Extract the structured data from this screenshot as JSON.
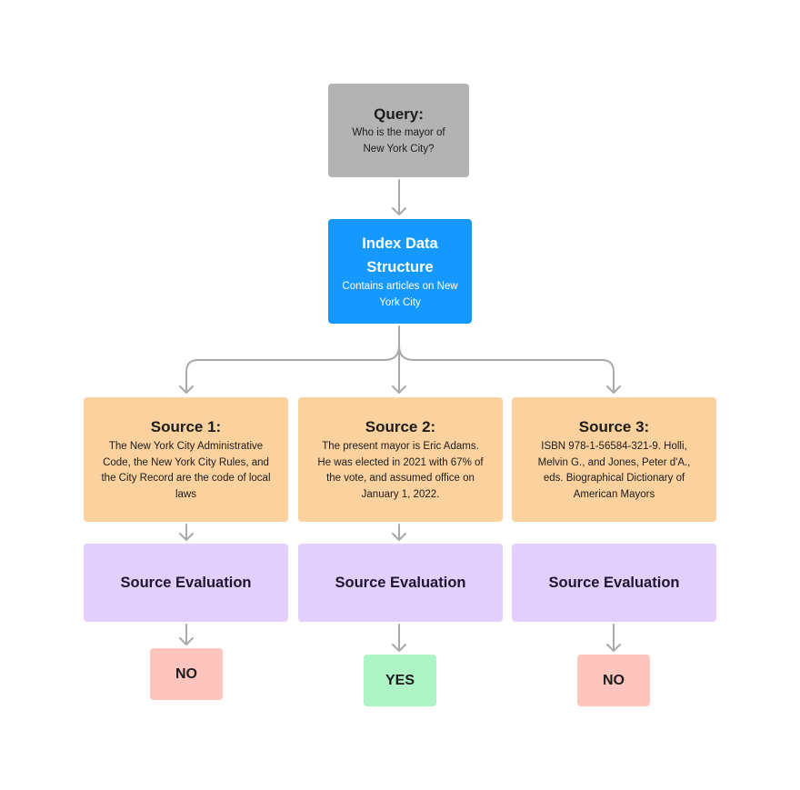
{
  "query": {
    "title": "Query:",
    "text": "Who is the mayor of New York City?"
  },
  "index": {
    "title": "Index Data Structure",
    "text": "Contains articles on New York City",
    "color": "#1599ff"
  },
  "sources": [
    {
      "title": "Source 1:",
      "text": "The New York City Administrative Code, the New York City Rules, and the City Record are the code of local laws"
    },
    {
      "title": "Source 2:",
      "text": "The present mayor is Eric Adams. He was elected in 2021 with 67% of the vote, and assumed office on January 1, 2022."
    },
    {
      "title": "Source 3:",
      "text": "ISBN 978-1-56584-321-9. Holli, Melvin G., and Jones, Peter d'A., eds. Biographical Dictionary of American Mayors"
    }
  ],
  "evaluations": [
    {
      "label": "Source Evaluation"
    },
    {
      "label": "Source Evaluation"
    },
    {
      "label": "Source Evaluation"
    }
  ],
  "verdicts": [
    {
      "label": "NO",
      "status": "no",
      "color": "#fec4be"
    },
    {
      "label": "YES",
      "status": "yes",
      "color": "#aff4c6"
    },
    {
      "label": "NO",
      "status": "no",
      "color": "#fec4be"
    }
  ],
  "colors": {
    "query": "#b3b3b3",
    "source": "#fbd19e",
    "evaluation": "#e3cffc",
    "connector": "#a9a9a9"
  },
  "connections": [
    {
      "from": "query",
      "to": "index"
    },
    {
      "from": "index",
      "to": "source-1"
    },
    {
      "from": "index",
      "to": "source-2"
    },
    {
      "from": "index",
      "to": "source-3"
    },
    {
      "from": "source-1",
      "to": "evaluation-1"
    },
    {
      "from": "source-2",
      "to": "evaluation-2"
    },
    {
      "from": "evaluation-1",
      "to": "verdict-1"
    },
    {
      "from": "evaluation-2",
      "to": "verdict-2"
    },
    {
      "from": "evaluation-3",
      "to": "verdict-3"
    }
  ]
}
